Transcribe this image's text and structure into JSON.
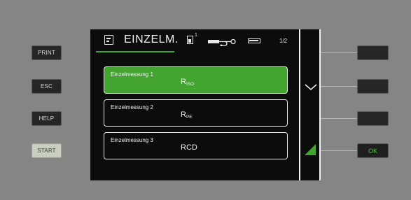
{
  "side_buttons": {
    "print": "PRINT",
    "esc": "ESC",
    "help": "HELP",
    "start": "START"
  },
  "header": {
    "title": "EINZELM.",
    "device_superscript": "1",
    "page": "1/2",
    "icons": [
      "document-icon",
      "device-icon",
      "cable-probe-icon",
      "battery-icon"
    ]
  },
  "items": [
    {
      "label": "Einzelmessung 1",
      "value_main": "R",
      "value_sub": "ISO",
      "selected": true
    },
    {
      "label": "Einzelmessung 2",
      "value_main": "R",
      "value_sub": "PE",
      "selected": false
    },
    {
      "label": "Einzelmessung 3",
      "value_main": "RCD",
      "value_sub": "",
      "selected": false
    }
  ],
  "soft_keys": {
    "key1": "",
    "key2": "",
    "key3": "",
    "key4": "OK"
  },
  "colors": {
    "accent": "#43a52f",
    "ok_text": "#4cc33b",
    "screen_bg": "#0c0c0c",
    "panel_bg": "#858585"
  }
}
